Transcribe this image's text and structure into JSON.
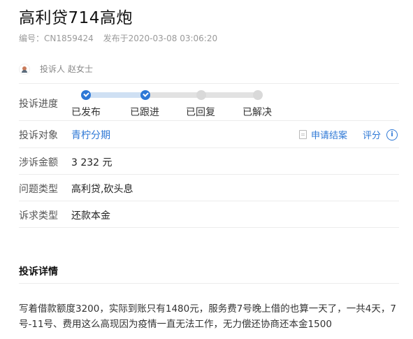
{
  "header": {
    "title": "高利贷714高炮",
    "id_label": "编号：CN1859424",
    "published": "发布于2020-03-08 03:06:20"
  },
  "complainant": {
    "label": "投诉人",
    "name": "赵女士"
  },
  "progress": {
    "label": "投诉进度",
    "steps": [
      {
        "label": "已发布",
        "done": true
      },
      {
        "label": "已跟进",
        "done": true
      },
      {
        "label": "已回复",
        "done": false
      },
      {
        "label": "已解决",
        "done": false
      }
    ]
  },
  "target": {
    "label": "投诉对象",
    "value": "青柠分期",
    "apply_label": "申请结案",
    "rate_label": "评分",
    "info_glyph": "i"
  },
  "amount": {
    "label": "涉诉金额",
    "value": "3 232 元"
  },
  "issue_type": {
    "label": "问题类型",
    "value": "高利贷,砍头息"
  },
  "demand_type": {
    "label": "诉求类型",
    "value": "还款本金"
  },
  "details": {
    "title": "投诉详情",
    "text": "写着借款额度3200，实际到账只有1480元，服务费7号晚上借的也算一天了，一共4天，7号-11号、费用这么高现因为疫情一直无法工作，无力偿还协商还本金1500"
  },
  "colors": {
    "accent": "#2e78d6",
    "muted": "#9a9a9a"
  },
  "icons": {
    "avatar": "avatar-icon",
    "document": "document-icon",
    "info": "info-icon",
    "check": "check-icon"
  }
}
